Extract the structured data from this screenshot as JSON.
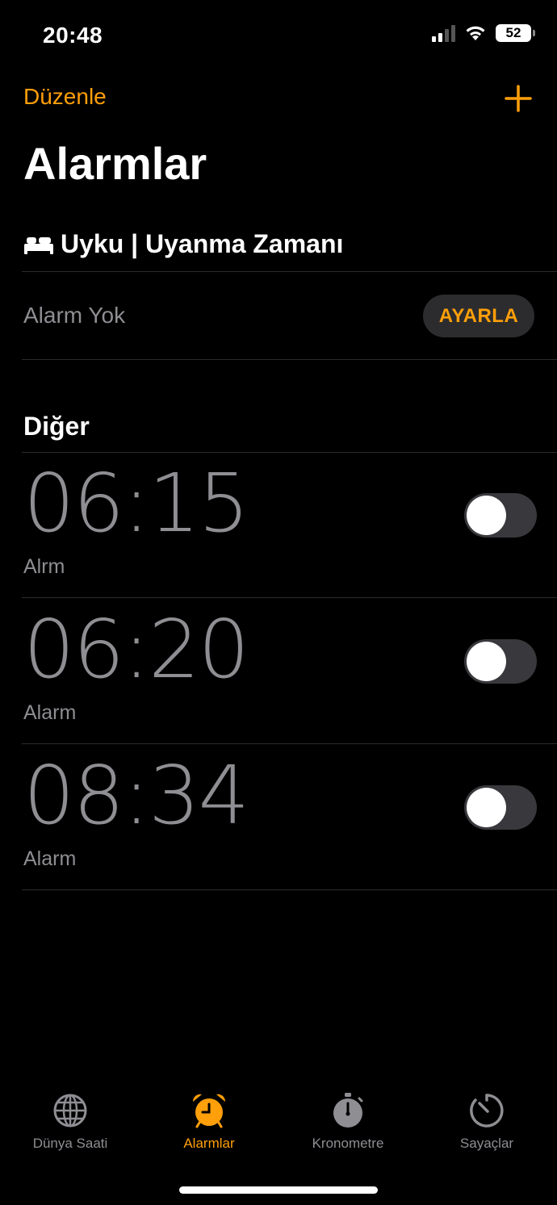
{
  "status_bar": {
    "time": "20:48",
    "battery": "52"
  },
  "header": {
    "edit_label": "Düzenle",
    "title": "Alarmlar"
  },
  "sleep": {
    "title": "Uyku | Uyanma Zamanı",
    "no_alarm_text": "Alarm Yok",
    "set_button_label": "AYARLA"
  },
  "other": {
    "title": "Diğer",
    "alarms": [
      {
        "time": "06:15",
        "label": "Alrm",
        "enabled": false
      },
      {
        "time": "06:20",
        "label": "Alarm",
        "enabled": false
      },
      {
        "time": "08:34",
        "label": "Alarm",
        "enabled": false
      }
    ]
  },
  "tabs": [
    {
      "label": "Dünya Saati",
      "icon": "globe-icon",
      "active": false
    },
    {
      "label": "Alarmlar",
      "icon": "alarm-clock-icon",
      "active": true
    },
    {
      "label": "Kronometre",
      "icon": "stopwatch-icon",
      "active": false
    },
    {
      "label": "Sayaçlar",
      "icon": "timer-icon",
      "active": false
    }
  ],
  "colors": {
    "accent": "#ff9f0a",
    "secondary_text": "#8e8e93",
    "toggle_off": "#39393d",
    "separator": "#2c2c2e"
  }
}
